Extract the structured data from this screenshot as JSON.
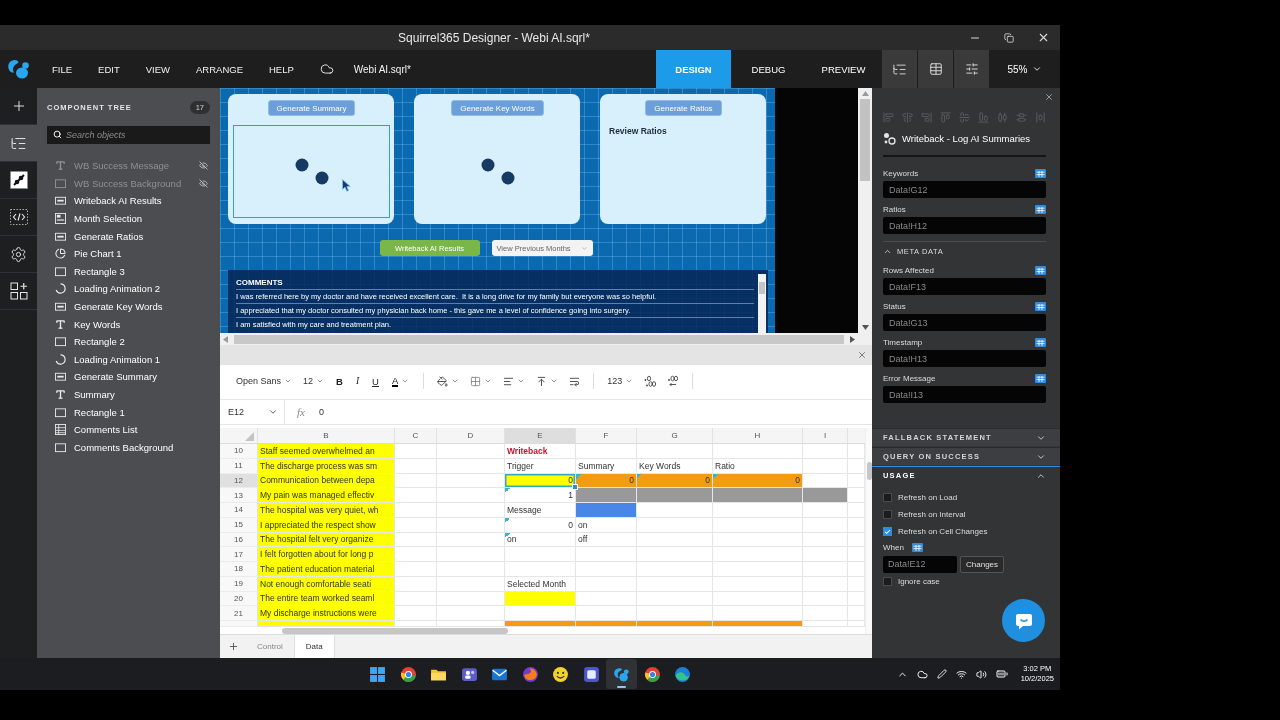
{
  "window": {
    "title": "Squirrel365 Designer - Webi AI.sqrl*"
  },
  "menu": {
    "items": [
      "FILE",
      "EDIT",
      "VIEW",
      "ARRANGE",
      "HELP"
    ],
    "file_name": "Webi AI.sqrl*",
    "modes": [
      {
        "label": "DESIGN",
        "selected": true
      },
      {
        "label": "DEBUG",
        "selected": false
      },
      {
        "label": "PREVIEW",
        "selected": false
      }
    ],
    "view_buttons": [
      {
        "kind": "tree",
        "selected": false
      },
      {
        "kind": "table",
        "selected": false
      },
      {
        "kind": "sliders",
        "selected": false
      }
    ],
    "zoom": "55%"
  },
  "rail": [
    {
      "kind": "add",
      "selected": false
    },
    {
      "kind": "tree",
      "selected": true
    },
    {
      "kind": "connect",
      "selected": false
    },
    {
      "kind": "code",
      "selected": false
    },
    {
      "kind": "settings",
      "selected": false
    },
    {
      "kind": "addons",
      "selected": false
    }
  ],
  "component_tree": {
    "title": "COMPONENT TREE",
    "count": "17",
    "search": {
      "placeholder": "Search objects"
    },
    "items": [
      {
        "label": "WB Success Message",
        "kind": "text",
        "hidden": true
      },
      {
        "label": "WB Success Background",
        "kind": "rectangle",
        "hidden": true
      },
      {
        "label": "Writeback AI Results",
        "kind": "button",
        "hidden": false
      },
      {
        "label": "Month Selection",
        "kind": "selection",
        "hidden": false
      },
      {
        "label": "Generate Ratios",
        "kind": "button",
        "hidden": false
      },
      {
        "label": "Pie Chart 1",
        "kind": "pie",
        "hidden": false
      },
      {
        "label": "Rectangle 3",
        "kind": "rectangle",
        "hidden": false
      },
      {
        "label": "Loading Animation 2",
        "kind": "loader",
        "hidden": false
      },
      {
        "label": "Generate Key Words",
        "kind": "button",
        "hidden": false
      },
      {
        "label": "Key Words",
        "kind": "text",
        "hidden": false
      },
      {
        "label": "Rectangle 2",
        "kind": "rectangle",
        "hidden": false
      },
      {
        "label": "Loading Animation 1",
        "kind": "loader",
        "hidden": false
      },
      {
        "label": "Generate Summary",
        "kind": "button",
        "hidden": false
      },
      {
        "label": "Summary",
        "kind": "text",
        "hidden": false
      },
      {
        "label": "Rectangle 1",
        "kind": "rectangle",
        "hidden": false
      },
      {
        "label": "Comments List",
        "kind": "list",
        "hidden": false
      },
      {
        "label": "Comments Background",
        "kind": "rectangle",
        "hidden": false
      }
    ]
  },
  "canvas": {
    "cards": [
      {
        "button": "Generate Summary",
        "kind": "loader",
        "outlined": true
      },
      {
        "button": "Generate Key Words",
        "kind": "loader",
        "outlined": false
      },
      {
        "button": "Generate Ratios",
        "kind": "text",
        "text": "Review Ratios",
        "outlined": false
      }
    ],
    "writeback_button": "Writeback AI Results",
    "month_dropdown": "View Previous Months",
    "comments": {
      "title": "COMMENTS",
      "rows": [
        "I was referred here by my doctor and have received excellent care.  It is a long drive for my family but everyone was so helpful.",
        "I appreciated that my doctor consulted my physician back home - this gave me a level of confidence going into surgery.",
        "I am satisfied with my care and treatment plan."
      ]
    }
  },
  "spreadsheet": {
    "toolbar": {
      "font": "Open Sans",
      "size": "12",
      "format_buttons": [
        {
          "label": "B",
          "kind": "bold"
        },
        {
          "label": "I",
          "kind": "italic"
        },
        {
          "label": "U",
          "kind": "underline"
        },
        {
          "label": "A",
          "kind": "color"
        }
      ],
      "number_format": "123"
    },
    "name_box": "E12",
    "formula_label": "fx",
    "formula": "0",
    "columns": [
      {
        "label": "B",
        "selected": false
      },
      {
        "label": "C",
        "selected": false
      },
      {
        "label": "D",
        "selected": false
      },
      {
        "label": "E",
        "selected": true
      },
      {
        "label": "F",
        "selected": false
      },
      {
        "label": "G",
        "selected": false
      },
      {
        "label": "H",
        "selected": false
      },
      {
        "label": "I",
        "selected": false
      }
    ],
    "rows": [
      {
        "kind": "full",
        "number": "10",
        "selected": false,
        "cells": [
          {
            "kind": "text",
            "text": "Staff seemed overwhelmed an",
            "color": "#ffff00",
            "selected": false,
            "note": false
          },
          {
            "kind": "empty",
            "selected": false,
            "note": false
          },
          {
            "kind": "empty",
            "selected": false,
            "note": false
          },
          {
            "kind": "heading",
            "text": "Writeback",
            "selected": false,
            "note": false
          },
          {
            "kind": "empty",
            "selected": false,
            "note": false
          },
          {
            "kind": "empty",
            "selected": false,
            "note": false
          },
          {
            "kind": "empty",
            "selected": false,
            "note": false
          },
          {
            "kind": "empty",
            "selected": false,
            "note": false
          }
        ]
      },
      {
        "kind": "full",
        "number": "11",
        "selected": false,
        "cells": [
          {
            "kind": "text",
            "text": "The discharge process was sm",
            "color": "#ffff00",
            "selected": false,
            "note": false
          },
          {
            "kind": "empty",
            "selected": false,
            "note": false
          },
          {
            "kind": "empty",
            "selected": false,
            "note": false
          },
          {
            "kind": "text",
            "text": "Trigger",
            "selected": false,
            "note": false
          },
          {
            "kind": "text",
            "text": "Summary",
            "selected": false,
            "note": false
          },
          {
            "kind": "text",
            "text": "Key Words",
            "selected": false,
            "note": false
          },
          {
            "kind": "text",
            "text": "Ratio",
            "selected": false,
            "note": false
          },
          {
            "kind": "empty",
            "selected": false,
            "note": false
          }
        ]
      },
      {
        "kind": "full",
        "number": "12",
        "selected": true,
        "cells": [
          {
            "kind": "text",
            "text": "Communication between depa",
            "color": "#ffff00",
            "selected": false,
            "note": false
          },
          {
            "kind": "empty",
            "selected": false,
            "note": false
          },
          {
            "kind": "empty",
            "selected": false,
            "note": false
          },
          {
            "kind": "number",
            "text": "0",
            "color": "#ffff00",
            "selected": true,
            "note": false
          },
          {
            "kind": "number",
            "text": "0",
            "color": "#f39c12",
            "selected": false,
            "note": true
          },
          {
            "kind": "number",
            "text": "0",
            "color": "#f39c12",
            "selected": false,
            "note": true
          },
          {
            "kind": "number",
            "text": "0",
            "color": "#f39c12",
            "selected": false,
            "note": true
          },
          {
            "kind": "empty",
            "selected": false,
            "note": false
          }
        ]
      },
      {
        "kind": "full",
        "number": "13",
        "selected": false,
        "cells": [
          {
            "kind": "text",
            "text": "My pain was managed effectiv",
            "color": "#ffff00",
            "selected": false,
            "note": false
          },
          {
            "kind": "empty",
            "selected": false,
            "note": false
          },
          {
            "kind": "empty",
            "selected": false,
            "note": false
          },
          {
            "kind": "number",
            "text": "1",
            "selected": false,
            "note": true
          },
          {
            "kind": "fill",
            "color": "#999999",
            "selected": false,
            "note": false
          },
          {
            "kind": "fill",
            "color": "#999999",
            "selected": false,
            "note": false
          },
          {
            "kind": "fill",
            "color": "#999999",
            "selected": false,
            "note": false
          },
          {
            "kind": "fill",
            "color": "#999999",
            "selected": false,
            "note": false
          }
        ]
      },
      {
        "kind": "full",
        "number": "14",
        "selected": false,
        "cells": [
          {
            "kind": "text",
            "text": "The hospital was very quiet, wh",
            "color": "#ffff00",
            "selected": false,
            "note": false
          },
          {
            "kind": "empty",
            "selected": false,
            "note": false
          },
          {
            "kind": "empty",
            "selected": false,
            "note": false
          },
          {
            "kind": "text",
            "text": "Message",
            "selected": false,
            "note": false
          },
          {
            "kind": "fill",
            "color": "#4a86e8",
            "selected": false,
            "note": false
          },
          {
            "kind": "empty",
            "selected": false,
            "note": false
          },
          {
            "kind": "empty",
            "selected": false,
            "note": false
          },
          {
            "kind": "empty",
            "selected": false,
            "note": false
          }
        ]
      },
      {
        "kind": "full",
        "number": "15",
        "selected": false,
        "cells": [
          {
            "kind": "text",
            "text": "I appreciated the respect show",
            "color": "#ffff00",
            "selected": false,
            "note": false
          },
          {
            "kind": "empty",
            "selected": false,
            "note": false
          },
          {
            "kind": "empty",
            "selected": false,
            "note": false
          },
          {
            "kind": "number",
            "text": "0",
            "selected": false,
            "note": true
          },
          {
            "kind": "text",
            "text": "on",
            "selected": false,
            "note": false
          },
          {
            "kind": "empty",
            "selected": false,
            "note": false
          },
          {
            "kind": "empty",
            "selected": false,
            "note": false
          },
          {
            "kind": "empty",
            "selected": false,
            "note": false
          }
        ]
      },
      {
        "kind": "full",
        "number": "16",
        "selected": false,
        "cells": [
          {
            "kind": "text",
            "text": "The hospital felt very organize",
            "color": "#ffff00",
            "selected": false,
            "note": false
          },
          {
            "kind": "empty",
            "selected": false,
            "note": false
          },
          {
            "kind": "empty",
            "selected": false,
            "note": false
          },
          {
            "kind": "text",
            "text": "on",
            "selected": false,
            "note": true
          },
          {
            "kind": "text",
            "text": "off",
            "selected": false,
            "note": false
          },
          {
            "kind": "empty",
            "selected": false,
            "note": false
          },
          {
            "kind": "empty",
            "selected": false,
            "note": false
          },
          {
            "kind": "empty",
            "selected": false,
            "note": false
          }
        ]
      },
      {
        "kind": "full",
        "number": "17",
        "selected": false,
        "cells": [
          {
            "kind": "text",
            "text": "I felt forgotten about for long p",
            "color": "#ffff00",
            "selected": false,
            "note": false
          },
          {
            "kind": "empty",
            "selected": false,
            "note": false
          },
          {
            "kind": "empty",
            "selected": false,
            "note": false
          },
          {
            "kind": "empty",
            "selected": false,
            "note": false
          },
          {
            "kind": "empty",
            "selected": false,
            "note": false
          },
          {
            "kind": "empty",
            "selected": false,
            "note": false
          },
          {
            "kind": "empty",
            "selected": false,
            "note": false
          },
          {
            "kind": "empty",
            "selected": false,
            "note": false
          }
        ]
      },
      {
        "kind": "full",
        "number": "18",
        "selected": false,
        "cells": [
          {
            "kind": "text",
            "text": "The patient education material",
            "color": "#ffff00",
            "selected": false,
            "note": false
          },
          {
            "kind": "empty",
            "selected": false,
            "note": false
          },
          {
            "kind": "empty",
            "selected": false,
            "note": false
          },
          {
            "kind": "empty",
            "selected": false,
            "note": false
          },
          {
            "kind": "empty",
            "selected": false,
            "note": false
          },
          {
            "kind": "empty",
            "selected": false,
            "note": false
          },
          {
            "kind": "empty",
            "selected": false,
            "note": false
          },
          {
            "kind": "empty",
            "selected": false,
            "note": false
          }
        ]
      },
      {
        "kind": "full",
        "number": "19",
        "selected": false,
        "cells": [
          {
            "kind": "text",
            "text": "Not enough comfortable seati",
            "color": "#ffff00",
            "selected": false,
            "note": false
          },
          {
            "kind": "empty",
            "selected": false,
            "note": false
          },
          {
            "kind": "empty",
            "selected": false,
            "note": false
          },
          {
            "kind": "text",
            "text": "Selected Month",
            "selected": false,
            "note": false
          },
          {
            "kind": "empty",
            "selected": false,
            "note": false
          },
          {
            "kind": "empty",
            "selected": false,
            "note": false
          },
          {
            "kind": "empty",
            "selected": false,
            "note": false
          },
          {
            "kind": "empty",
            "selected": false,
            "note": false
          }
        ]
      },
      {
        "kind": "full",
        "number": "20",
        "selected": false,
        "cells": [
          {
            "kind": "text",
            "text": "The entire team worked seaml",
            "color": "#ffff00",
            "selected": false,
            "note": false
          },
          {
            "kind": "empty",
            "selected": false,
            "note": false
          },
          {
            "kind": "empty",
            "selected": false,
            "note": false
          },
          {
            "kind": "fill",
            "color": "#ffff00",
            "selected": false,
            "note": false
          },
          {
            "kind": "empty",
            "selected": false,
            "note": false
          },
          {
            "kind": "empty",
            "selected": false,
            "note": false
          },
          {
            "kind": "empty",
            "selected": false,
            "note": false
          },
          {
            "kind": "empty",
            "selected": false,
            "note": false
          }
        ]
      },
      {
        "kind": "full",
        "number": "21",
        "selected": false,
        "cells": [
          {
            "kind": "text",
            "text": "My discharge instructions were",
            "color": "#ffff00",
            "selected": false,
            "note": false
          },
          {
            "kind": "empty",
            "selected": false,
            "note": false
          },
          {
            "kind": "empty",
            "selected": false,
            "note": false
          },
          {
            "kind": "empty",
            "selected": false,
            "note": false
          },
          {
            "kind": "empty",
            "selected": false,
            "note": false
          },
          {
            "kind": "empty",
            "selected": false,
            "note": false
          },
          {
            "kind": "empty",
            "selected": false,
            "note": false
          },
          {
            "kind": "empty",
            "selected": false,
            "note": false
          }
        ]
      },
      {
        "kind": "partial",
        "selected": false,
        "cells": [
          {
            "kind": "fill",
            "color": "#ffff00",
            "selected": false,
            "note": false
          },
          {
            "kind": "empty",
            "selected": false,
            "note": false
          },
          {
            "kind": "empty",
            "selected": false,
            "note": false
          },
          {
            "kind": "fill",
            "color": "#f39c12",
            "selected": false,
            "note": false
          },
          {
            "kind": "fill",
            "color": "#f39c12",
            "selected": false,
            "note": false
          },
          {
            "kind": "fill",
            "color": "#f39c12",
            "selected": false,
            "note": false
          },
          {
            "kind": "fill",
            "color": "#f39c12",
            "selected": false,
            "note": false
          },
          {
            "kind": "empty",
            "selected": false,
            "note": false
          }
        ]
      }
    ],
    "sheets": [
      {
        "label": "Control",
        "selected": false
      },
      {
        "label": "Data",
        "selected": true
      }
    ]
  },
  "properties": {
    "align_tools": {
      "disabled": true
    },
    "title": "Writeback - Log AI Summaries",
    "fields": [
      {
        "label": "Keywords",
        "value": "Data!G12"
      },
      {
        "label": "Ratios",
        "value": "Data!H12"
      }
    ],
    "meta": {
      "title": "META DATA",
      "expanded": true,
      "fields": [
        {
          "label": "Rows Affected",
          "value": "Data!F13"
        },
        {
          "label": "Status",
          "value": "Data!G13"
        },
        {
          "label": "Timestamp",
          "value": "Data!H13"
        },
        {
          "label": "Error Message",
          "value": "Data!I13"
        }
      ]
    },
    "sections": [
      {
        "title": "FALLBACK STATEMENT",
        "expanded": false
      },
      {
        "title": "QUERY ON SUCCESS",
        "expanded": false
      },
      {
        "title": "USAGE",
        "expanded": true,
        "options": [
          {
            "label": "Refresh on Load",
            "checked": false
          },
          {
            "label": "Refresh on Interval",
            "checked": false
          },
          {
            "label": "Refresh on Cell Changes",
            "checked": true
          }
        ],
        "when": {
          "label": "When",
          "value": "Data!E12",
          "button": "Changes"
        },
        "ignore_case": {
          "label": "Ignore case",
          "checked": false
        }
      }
    ]
  },
  "taskbar": {
    "apps": [
      {
        "kind": "grid",
        "selected": false
      },
      {
        "kind": "ring",
        "selected": false
      },
      {
        "kind": "folder",
        "selected": false
      },
      {
        "kind": "people",
        "selected": false
      },
      {
        "kind": "mail",
        "selected": false
      },
      {
        "kind": "flame",
        "selected": false
      },
      {
        "kind": "smiley",
        "selected": false
      },
      {
        "kind": "tile",
        "selected": false
      },
      {
        "kind": "squirrel",
        "selected": true
      },
      {
        "kind": "ring",
        "selected": false
      },
      {
        "kind": "wave",
        "selected": false
      }
    ],
    "time": "3:02 PM",
    "date": "10/2/2025"
  }
}
